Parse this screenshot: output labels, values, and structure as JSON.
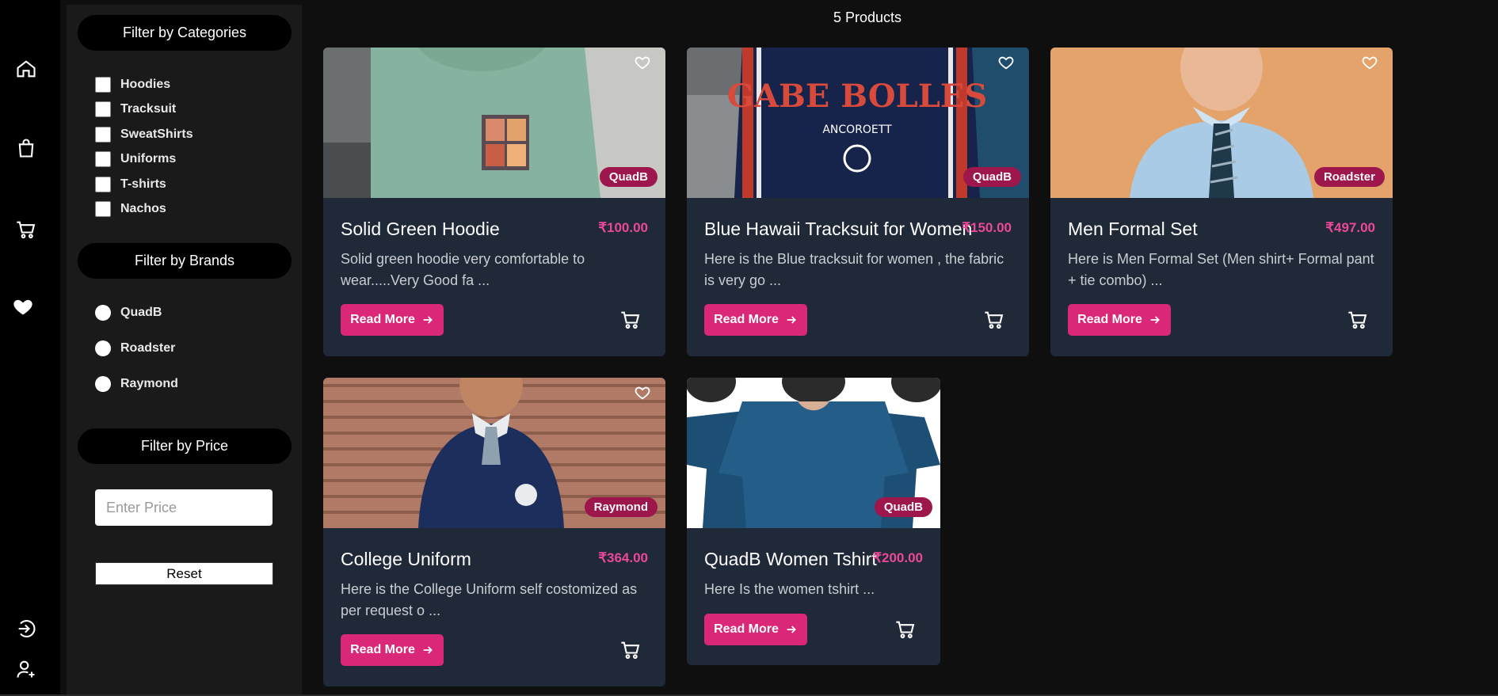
{
  "nav": {
    "items": [
      "home-icon",
      "shopping-bag-icon",
      "cart-icon",
      "heart-icon"
    ],
    "bottom": [
      "login-icon",
      "add-user-icon"
    ]
  },
  "filters": {
    "categories_title": "Filter by Categories",
    "categories": [
      "Hoodies",
      "Tracksuit",
      "SweatShirts",
      "Uniforms",
      "T-shirts",
      "Nachos"
    ],
    "brands_title": "Filter by Brands",
    "brands": [
      "QuadB",
      "Roadster",
      "Raymond"
    ],
    "price_title": "Filter by Price",
    "price_placeholder": "Enter Price",
    "reset_label": "Reset"
  },
  "products_count": "5 Products",
  "read_more_label": "Read More",
  "colors": {
    "accent": "#db2777",
    "price": "#ec4899",
    "badge": "#9d174d",
    "card": "#1f2937"
  },
  "products": [
    {
      "title": "Solid Green Hoodie",
      "price": "₹100.00",
      "brand": "QuadB",
      "desc": "Solid green hoodie very comfortable to wear.....Very Good fa ..."
    },
    {
      "title": "Blue Hawaii Tracksuit for Women",
      "price": "₹150.00",
      "brand": "QuadB",
      "desc": "Here is the Blue tracksuit for women , the fabric is very go ..."
    },
    {
      "title": "Men Formal Set",
      "price": "₹497.00",
      "brand": "Roadster",
      "desc": "Here is Men Formal Set (Men shirt+ Formal pant + tie combo) ..."
    },
    {
      "title": "College Uniform",
      "price": "₹364.00",
      "brand": "Raymond",
      "desc": "Here is the College Uniform self costomized as per request o ..."
    },
    {
      "title": "QuadB Women Tshirt",
      "price": "₹200.00",
      "brand": "QuadB",
      "desc": "Here Is the women tshirt ..."
    }
  ]
}
